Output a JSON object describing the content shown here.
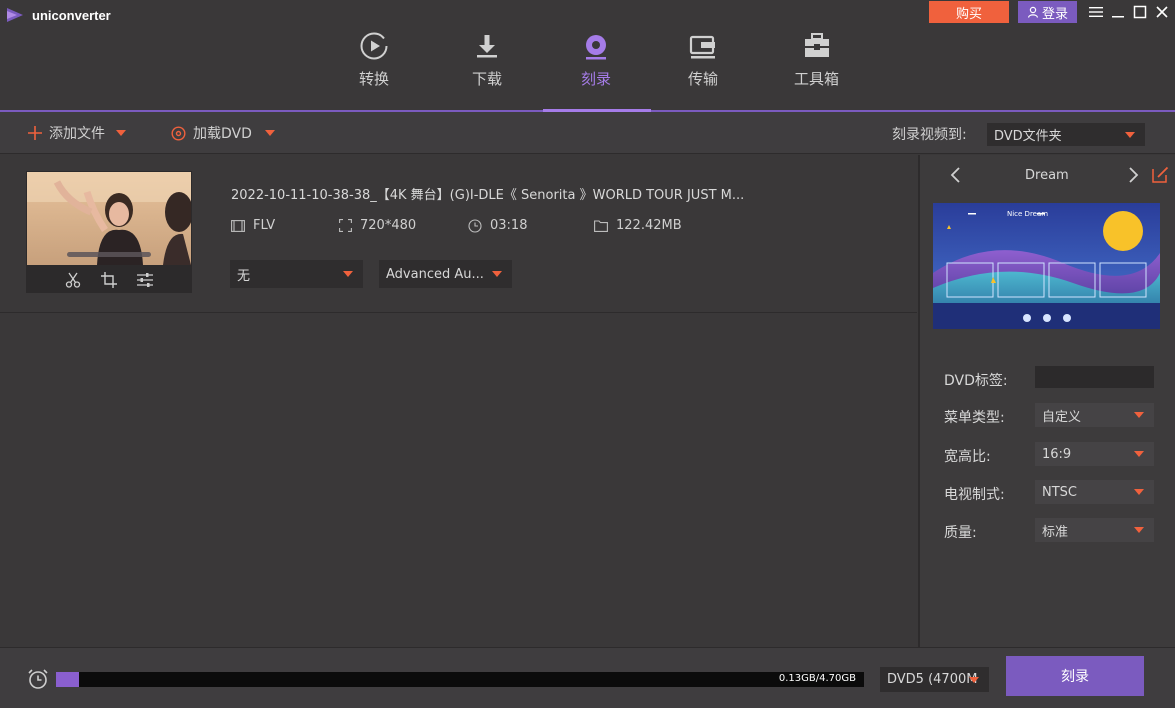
{
  "app": {
    "title": "uniconverter"
  },
  "window": {
    "buy_label": "购买",
    "login_label": "登录"
  },
  "nav": {
    "tabs": [
      {
        "label": "转换",
        "icon": "convert-icon"
      },
      {
        "label": "下载",
        "icon": "download-icon"
      },
      {
        "label": "刻录",
        "icon": "burn-disc-icon",
        "active": true
      },
      {
        "label": "传输",
        "icon": "transfer-icon"
      },
      {
        "label": "工具箱",
        "icon": "toolbox-icon"
      }
    ]
  },
  "toolbar": {
    "add_file": "添加文件",
    "load_dvd": "加载DVD",
    "burn_to_label": "刻录视频到:",
    "burn_to_value": "DVD文件夹"
  },
  "file": {
    "name": "2022-10-11-10-38-38_【4K 舞台】(G)I-DLE《 Senorita 》WORLD TOUR JUST M...",
    "format": "FLV",
    "resolution": "720*480",
    "duration": "03:18",
    "size": "122.42MB",
    "subtitle": "无",
    "audio": "Advanced Au..."
  },
  "template": {
    "name": "Dream",
    "preview_title": "Nice Dream"
  },
  "props": {
    "dvd_label": "DVD标签:",
    "dvd_label_value": "",
    "menu_type": "菜单类型:",
    "menu_type_value": "自定义",
    "aspect": "宽高比:",
    "aspect_value": "16:9",
    "tv_std": "电视制式:",
    "tv_std_value": "NTSC",
    "quality": "质量:",
    "quality_value": "标准"
  },
  "bottom": {
    "usage": "0.13GB/4.70GB",
    "usage_fraction": 0.028,
    "disc": "DVD5 (4700M",
    "burn": "刻录"
  },
  "colors": {
    "accent": "#7b5bbf",
    "accent_light": "#a57ce8",
    "orange": "#f0613d",
    "bg": "#3a3839"
  }
}
